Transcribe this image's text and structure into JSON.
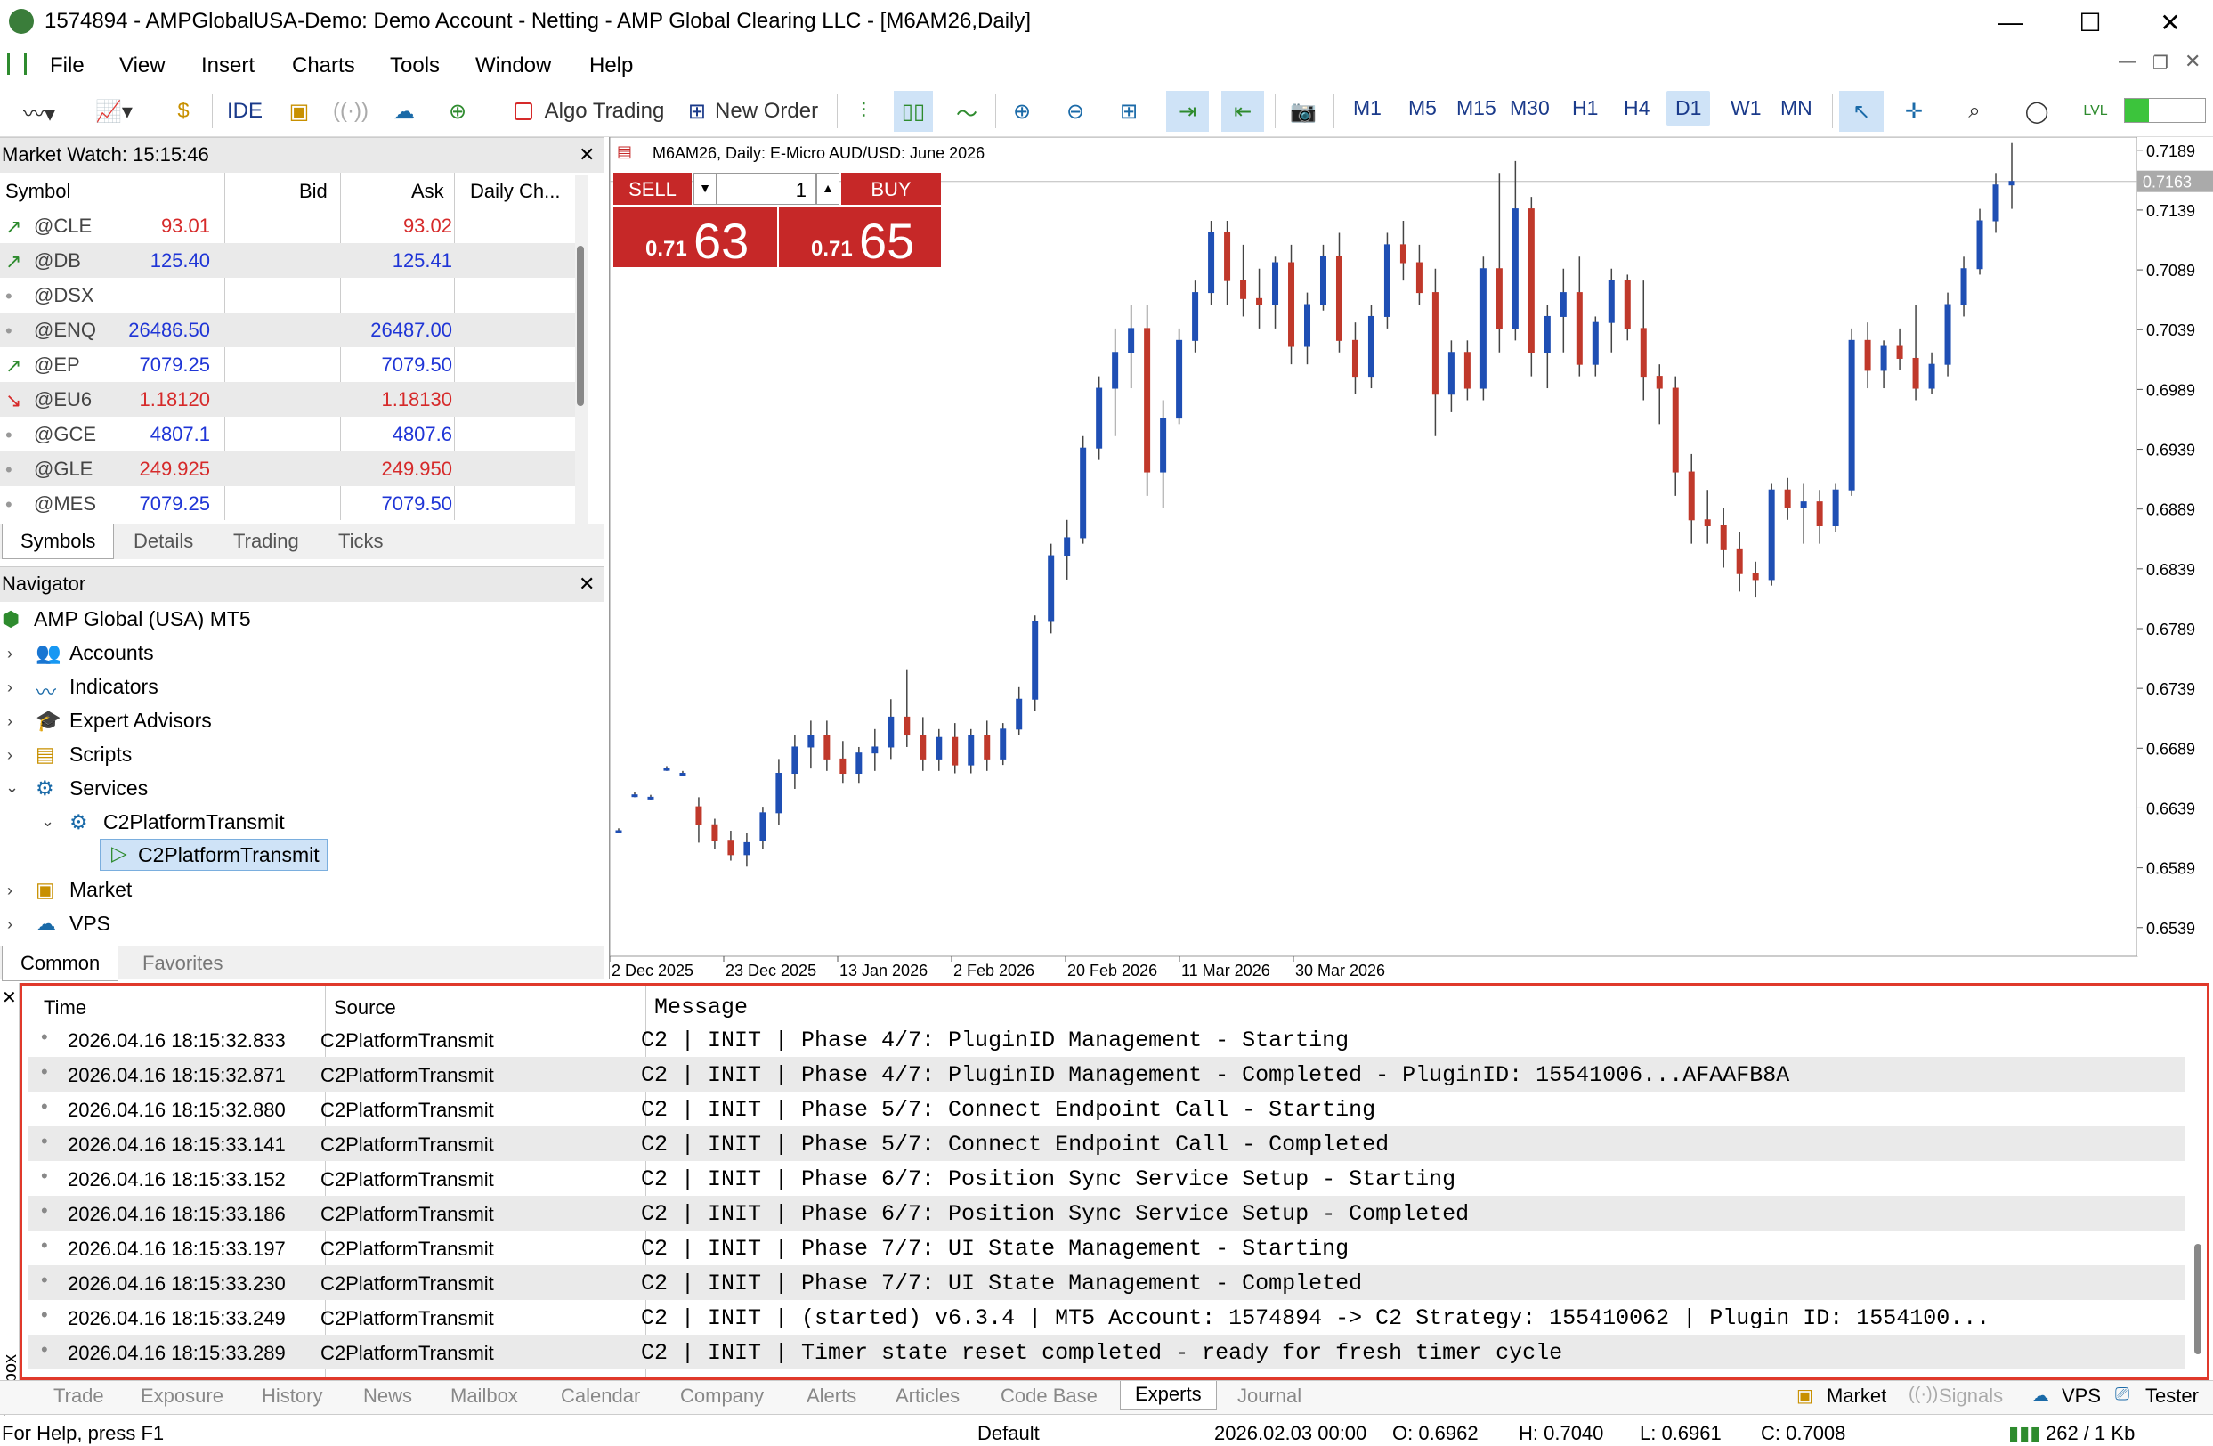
{
  "window": {
    "title": "1574894 - AMPGlobalUSA-Demo: Demo Account - Netting - AMP Global Clearing LLC - [M6AM26,Daily]"
  },
  "menu": [
    "File",
    "View",
    "Insert",
    "Charts",
    "Tools",
    "Window",
    "Help"
  ],
  "toolbar": {
    "ide": "IDE",
    "algo": "Algo Trading",
    "new_order": "New Order",
    "timeframes": [
      "M1",
      "M5",
      "M15",
      "M30",
      "H1",
      "H4",
      "D1",
      "W1",
      "MN"
    ],
    "selected_tf": "D1"
  },
  "market_watch": {
    "title": "Market Watch: 15:15:46",
    "headers": [
      "Symbol",
      "Bid",
      "Ask",
      "Daily Ch..."
    ],
    "rows": [
      {
        "symbol": "@CLE",
        "bid": "93.01",
        "ask": "93.02",
        "dir": "up",
        "color": "#d62a2a"
      },
      {
        "symbol": "@DB",
        "bid": "125.40",
        "ask": "125.41",
        "dir": "up",
        "color": "#1f35d6"
      },
      {
        "symbol": "@DSX",
        "bid": "",
        "ask": "",
        "dir": "none",
        "color": "#1f35d6"
      },
      {
        "symbol": "@ENQ",
        "bid": "26486.50",
        "ask": "26487.00",
        "dir": "none",
        "color": "#1f35d6"
      },
      {
        "symbol": "@EP",
        "bid": "7079.25",
        "ask": "7079.50",
        "dir": "up",
        "color": "#1f35d6"
      },
      {
        "symbol": "@EU6",
        "bid": "1.18120",
        "ask": "1.18130",
        "dir": "down",
        "color": "#d62a2a"
      },
      {
        "symbol": "@GCE",
        "bid": "4807.1",
        "ask": "4807.6",
        "dir": "none",
        "color": "#1f35d6"
      },
      {
        "symbol": "@GLE",
        "bid": "249.925",
        "ask": "249.950",
        "dir": "none",
        "color": "#d62a2a"
      },
      {
        "symbol": "@MES",
        "bid": "7079.25",
        "ask": "7079.50",
        "dir": "none",
        "color": "#1f35d6"
      }
    ],
    "tabs": [
      "Symbols",
      "Details",
      "Trading",
      "Ticks"
    ]
  },
  "navigator": {
    "title": "Navigator",
    "root": "AMP Global (USA) MT5",
    "items": [
      "Accounts",
      "Indicators",
      "Expert Advisors",
      "Scripts",
      "Services",
      "C2PlatformTransmit",
      "C2PlatformTransmit",
      "Market",
      "VPS"
    ],
    "tabs": [
      "Common",
      "Favorites"
    ]
  },
  "chart": {
    "header": "M6AM26, Daily:  E-Micro AUD/USD: June 2026",
    "sell_label": "SELL",
    "buy_label": "BUY",
    "volume": "1",
    "sell_prefix": "0.71",
    "sell_big": "63",
    "buy_prefix": "0.71",
    "buy_big": "65",
    "current_price": "0.7163"
  },
  "chart_data": {
    "type": "candlestick",
    "x_ticks": [
      "2 Dec 2025",
      "23 Dec 2025",
      "13 Jan 2026",
      "2 Feb 2026",
      "20 Feb 2026",
      "11 Mar 2026",
      "30 Mar 2026"
    ],
    "y_ticks": [
      "0.7189",
      "0.7139",
      "0.7089",
      "0.7039",
      "0.6989",
      "0.6939",
      "0.6889",
      "0.6839",
      "0.6789",
      "0.6739",
      "0.6689",
      "0.6639",
      "0.6589",
      "0.6539"
    ],
    "ylim": [
      0.6515,
      0.72
    ],
    "candles": [
      [
        0.662,
        0.6622,
        0.6618,
        0.662
      ],
      [
        0.665,
        0.6652,
        0.6648,
        0.665
      ],
      [
        0.6648,
        0.665,
        0.6646,
        0.6648
      ],
      [
        0.6672,
        0.6674,
        0.667,
        0.6672
      ],
      [
        0.6668,
        0.667,
        0.6666,
        0.6668
      ],
      [
        0.664,
        0.6648,
        0.661,
        0.6625
      ],
      [
        0.6625,
        0.663,
        0.6605,
        0.6612
      ],
      [
        0.6612,
        0.662,
        0.6595,
        0.66
      ],
      [
        0.66,
        0.6618,
        0.659,
        0.661
      ],
      [
        0.6612,
        0.664,
        0.6605,
        0.6635
      ],
      [
        0.6635,
        0.668,
        0.6625,
        0.6668
      ],
      [
        0.6668,
        0.67,
        0.6655,
        0.669
      ],
      [
        0.669,
        0.6712,
        0.6672,
        0.67
      ],
      [
        0.67,
        0.6712,
        0.667,
        0.668
      ],
      [
        0.668,
        0.6695,
        0.666,
        0.6668
      ],
      [
        0.6668,
        0.669,
        0.666,
        0.6685
      ],
      [
        0.6685,
        0.6705,
        0.667,
        0.669
      ],
      [
        0.669,
        0.673,
        0.668,
        0.6715
      ],
      [
        0.6715,
        0.6755,
        0.669,
        0.67
      ],
      [
        0.67,
        0.6715,
        0.667,
        0.668
      ],
      [
        0.668,
        0.6705,
        0.667,
        0.6698
      ],
      [
        0.6698,
        0.671,
        0.6668,
        0.6675
      ],
      [
        0.6675,
        0.6705,
        0.6668,
        0.67
      ],
      [
        0.67,
        0.6712,
        0.667,
        0.668
      ],
      [
        0.668,
        0.671,
        0.6675,
        0.6705
      ],
      [
        0.6705,
        0.674,
        0.67,
        0.673
      ],
      [
        0.673,
        0.68,
        0.672,
        0.6795
      ],
      [
        0.6795,
        0.686,
        0.6785,
        0.685
      ],
      [
        0.685,
        0.688,
        0.683,
        0.6865
      ],
      [
        0.6865,
        0.695,
        0.686,
        0.694
      ],
      [
        0.694,
        0.7,
        0.693,
        0.699
      ],
      [
        0.699,
        0.704,
        0.695,
        0.702
      ],
      [
        0.702,
        0.706,
        0.699,
        0.704
      ],
      [
        0.704,
        0.706,
        0.69,
        0.692
      ],
      [
        0.692,
        0.698,
        0.689,
        0.6965
      ],
      [
        0.6965,
        0.704,
        0.696,
        0.703
      ],
      [
        0.703,
        0.708,
        0.702,
        0.707
      ],
      [
        0.707,
        0.713,
        0.706,
        0.712
      ],
      [
        0.712,
        0.713,
        0.706,
        0.708
      ],
      [
        0.708,
        0.711,
        0.705,
        0.7065
      ],
      [
        0.7065,
        0.709,
        0.704,
        0.706
      ],
      [
        0.706,
        0.71,
        0.704,
        0.7095
      ],
      [
        0.7095,
        0.711,
        0.701,
        0.7025
      ],
      [
        0.7025,
        0.707,
        0.701,
        0.706
      ],
      [
        0.706,
        0.711,
        0.7055,
        0.71
      ],
      [
        0.71,
        0.712,
        0.702,
        0.703
      ],
      [
        0.703,
        0.7045,
        0.6985,
        0.7
      ],
      [
        0.7,
        0.706,
        0.699,
        0.705
      ],
      [
        0.705,
        0.712,
        0.704,
        0.711
      ],
      [
        0.711,
        0.713,
        0.708,
        0.7095
      ],
      [
        0.7095,
        0.711,
        0.706,
        0.707
      ],
      [
        0.707,
        0.709,
        0.695,
        0.6985
      ],
      [
        0.6985,
        0.703,
        0.697,
        0.702
      ],
      [
        0.702,
        0.703,
        0.698,
        0.699
      ],
      [
        0.699,
        0.71,
        0.698,
        0.709
      ],
      [
        0.709,
        0.717,
        0.702,
        0.704
      ],
      [
        0.704,
        0.718,
        0.703,
        0.714
      ],
      [
        0.714,
        0.715,
        0.7,
        0.702
      ],
      [
        0.702,
        0.706,
        0.699,
        0.705
      ],
      [
        0.705,
        0.709,
        0.702,
        0.707
      ],
      [
        0.707,
        0.71,
        0.7,
        0.701
      ],
      [
        0.701,
        0.705,
        0.7,
        0.7045
      ],
      [
        0.7045,
        0.709,
        0.702,
        0.708
      ],
      [
        0.708,
        0.7085,
        0.703,
        0.704
      ],
      [
        0.704,
        0.708,
        0.698,
        0.7
      ],
      [
        0.7,
        0.701,
        0.696,
        0.699
      ],
      [
        0.699,
        0.7,
        0.69,
        0.692
      ],
      [
        0.692,
        0.6935,
        0.686,
        0.688
      ],
      [
        0.688,
        0.6905,
        0.686,
        0.6875
      ],
      [
        0.6875,
        0.689,
        0.684,
        0.6855
      ],
      [
        0.6855,
        0.687,
        0.682,
        0.6835
      ],
      [
        0.6835,
        0.6845,
        0.6815,
        0.683
      ],
      [
        0.683,
        0.691,
        0.6825,
        0.6905
      ],
      [
        0.6905,
        0.6915,
        0.688,
        0.689
      ],
      [
        0.689,
        0.691,
        0.686,
        0.6895
      ],
      [
        0.6895,
        0.6905,
        0.686,
        0.6875
      ],
      [
        0.6875,
        0.691,
        0.687,
        0.6905
      ],
      [
        0.6905,
        0.704,
        0.69,
        0.703
      ],
      [
        0.703,
        0.7045,
        0.699,
        0.7005
      ],
      [
        0.7005,
        0.703,
        0.699,
        0.7025
      ],
      [
        0.7025,
        0.704,
        0.7005,
        0.7015
      ],
      [
        0.7015,
        0.706,
        0.698,
        0.699
      ],
      [
        0.699,
        0.702,
        0.6985,
        0.701
      ],
      [
        0.701,
        0.707,
        0.7,
        0.706
      ],
      [
        0.706,
        0.71,
        0.705,
        0.709
      ],
      [
        0.709,
        0.714,
        0.7085,
        0.713
      ],
      [
        0.713,
        0.717,
        0.712,
        0.716
      ],
      [
        0.716,
        0.7195,
        0.714,
        0.7163
      ]
    ]
  },
  "toolbox": {
    "label": "Toolbox",
    "headers": [
      "Time",
      "Source",
      "Message"
    ],
    "rows": [
      {
        "time": "2026.04.16 18:15:32.833",
        "source": "C2PlatformTransmit",
        "message": "C2 | INIT | Phase 4/7: PluginID Management - Starting"
      },
      {
        "time": "2026.04.16 18:15:32.871",
        "source": "C2PlatformTransmit",
        "message": "C2 | INIT | Phase 4/7: PluginID Management - Completed - PluginID: 15541006...AFAAFB8A"
      },
      {
        "time": "2026.04.16 18:15:32.880",
        "source": "C2PlatformTransmit",
        "message": "C2 | INIT | Phase 5/7: Connect Endpoint Call - Starting"
      },
      {
        "time": "2026.04.16 18:15:33.141",
        "source": "C2PlatformTransmit",
        "message": "C2 | INIT | Phase 5/7: Connect Endpoint Call - Completed"
      },
      {
        "time": "2026.04.16 18:15:33.152",
        "source": "C2PlatformTransmit",
        "message": "C2 | INIT | Phase 6/7: Position Sync Service Setup - Starting"
      },
      {
        "time": "2026.04.16 18:15:33.186",
        "source": "C2PlatformTransmit",
        "message": "C2 | INIT | Phase 6/7: Position Sync Service Setup - Completed"
      },
      {
        "time": "2026.04.16 18:15:33.197",
        "source": "C2PlatformTransmit",
        "message": "C2 | INIT | Phase 7/7: UI State Management - Starting"
      },
      {
        "time": "2026.04.16 18:15:33.230",
        "source": "C2PlatformTransmit",
        "message": "C2 | INIT | Phase 7/7: UI State Management - Completed"
      },
      {
        "time": "2026.04.16 18:15:33.249",
        "source": "C2PlatformTransmit",
        "message": "C2 | INIT | (started) v6.3.4 | MT5 Account: 1574894 -> C2 Strategy: 155410062 | Plugin ID: 1554100..."
      },
      {
        "time": "2026.04.16 18:15:33.289",
        "source": "C2PlatformTransmit",
        "message": "C2 | INIT | Timer state reset completed - ready for fresh timer cycle"
      }
    ],
    "tabs": [
      "Trade",
      "Exposure",
      "History",
      "News",
      "Mailbox",
      "Calendar",
      "Company",
      "Alerts",
      "Articles",
      "Code Base",
      "Experts",
      "Journal"
    ],
    "selected_tab": "Experts",
    "right_tabs": [
      "Market",
      "Signals",
      "VPS",
      "Tester"
    ]
  },
  "status": {
    "help": "For Help, press F1",
    "profile": "Default",
    "datetime": "2026.02.03 00:00",
    "open": "O: 0.6962",
    "high": "H: 0.7040",
    "low": "L: 0.6961",
    "close": "C: 0.7008",
    "traffic": "262 / 1 Kb"
  },
  "colors": {
    "bull": "#1f4fb4",
    "bear": "#c0392b",
    "highlight": "#e0392b",
    "sell_bg": "#c62828"
  }
}
